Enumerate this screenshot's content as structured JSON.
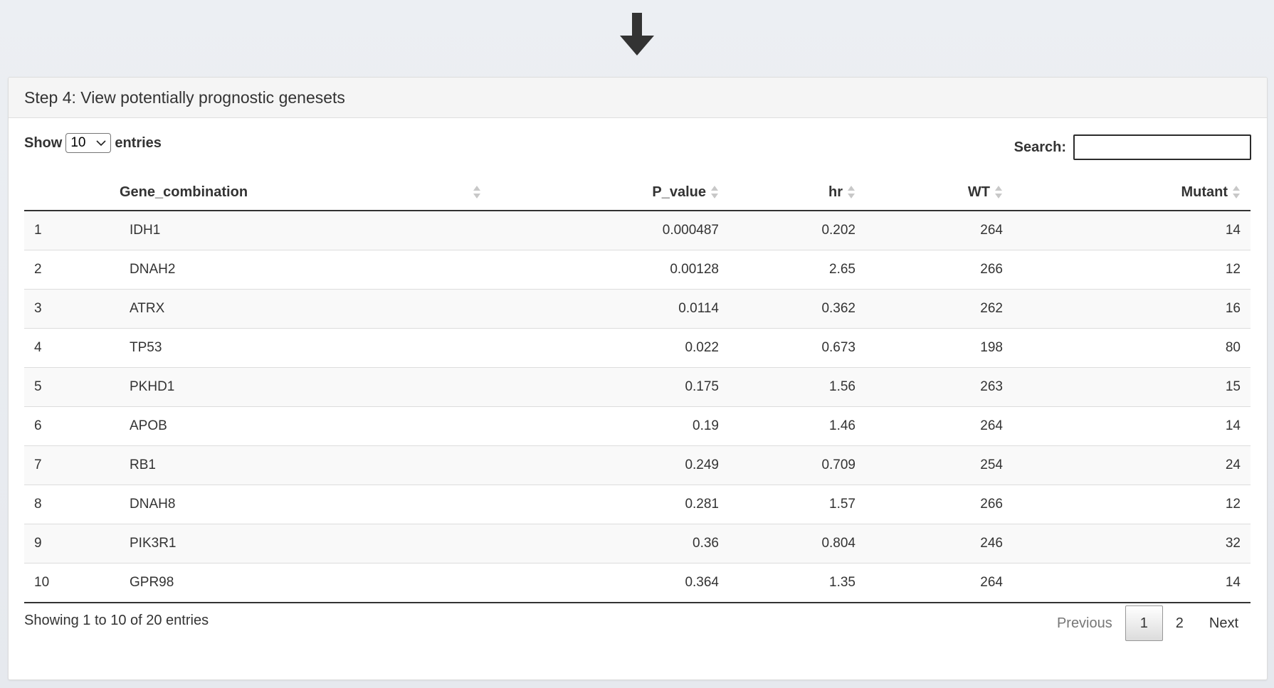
{
  "panel": {
    "title": "Step 4: View potentially prognostic genesets"
  },
  "length_menu": {
    "show_label": "Show",
    "selected": "10",
    "entries_label": "entries"
  },
  "search": {
    "label": "Search:",
    "value": ""
  },
  "table": {
    "columns": [
      "",
      "Gene_combination",
      "P_value",
      "hr",
      "WT",
      "Mutant"
    ],
    "rows": [
      [
        "1",
        "IDH1",
        "0.000487",
        "0.202",
        "264",
        "14"
      ],
      [
        "2",
        "DNAH2",
        "0.00128",
        "2.65",
        "266",
        "12"
      ],
      [
        "3",
        "ATRX",
        "0.0114",
        "0.362",
        "262",
        "16"
      ],
      [
        "4",
        "TP53",
        "0.022",
        "0.673",
        "198",
        "80"
      ],
      [
        "5",
        "PKHD1",
        "0.175",
        "1.56",
        "263",
        "15"
      ],
      [
        "6",
        "APOB",
        "0.19",
        "1.46",
        "264",
        "14"
      ],
      [
        "7",
        "RB1",
        "0.249",
        "0.709",
        "254",
        "24"
      ],
      [
        "8",
        "DNAH8",
        "0.281",
        "1.57",
        "266",
        "12"
      ],
      [
        "9",
        "PIK3R1",
        "0.36",
        "0.804",
        "246",
        "32"
      ],
      [
        "10",
        "GPR98",
        "0.364",
        "1.35",
        "264",
        "14"
      ]
    ]
  },
  "info": "Showing 1 to 10 of 20 entries",
  "pagination": {
    "previous": "Previous",
    "pages": [
      "1",
      "2"
    ],
    "current": "1",
    "next": "Next"
  },
  "icons": {
    "top_arrow": "arrow-down-icon",
    "select": "chevron-down-icon",
    "sort": "sort-both-icon"
  },
  "colors": {
    "page_bg": "#eceff3",
    "header_bg": "#f5f5f5",
    "arrow": "#333333"
  }
}
